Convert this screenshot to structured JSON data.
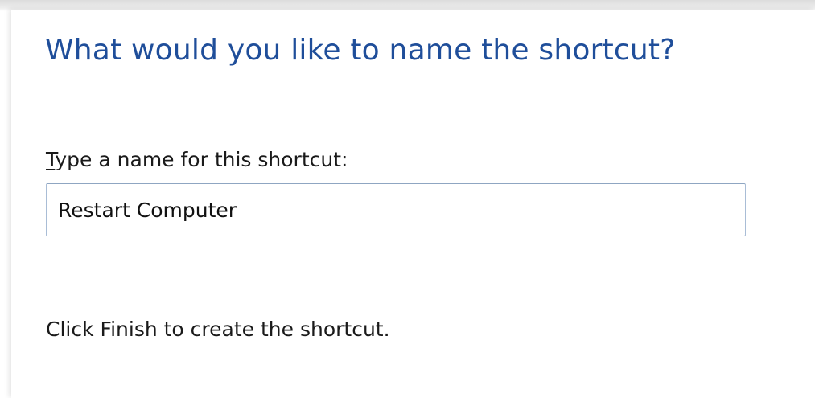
{
  "wizard": {
    "heading": "What would you like to name the shortcut?",
    "name_label_accel": "T",
    "name_label_rest": "ype a name for this shortcut:",
    "name_value": "Restart Computer",
    "instruction": "Click Finish to create the shortcut."
  },
  "colors": {
    "heading": "#1f4e9a",
    "text": "#1a1a1a",
    "input_border": "#a9bdd6"
  }
}
